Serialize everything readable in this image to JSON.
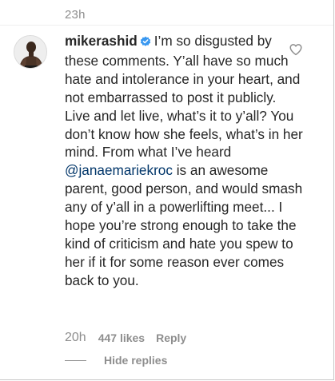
{
  "previous_comment": {
    "timestamp": "23h"
  },
  "comment": {
    "username": "mikerashid",
    "verified": true,
    "text_part1": "I’m so disgusted by these comments. Y’all have so much hate and intolerance in your heart, and not embarrassed to post it publicly. Live and let live, what’s it to y’all? You don’t know how she feels, what’s in her mind. From what I’ve heard ",
    "mention": "@janaemariekroc",
    "text_part2": " is an awesome parent, good person, and would smash any of y’all in a powerlifting meet... I hope you’re strong enough to take the kind of criticism and hate you spew to her if it for some reason ever comes back to you.",
    "timestamp": "20h",
    "likes": "447 likes",
    "reply_label": "Reply",
    "hide_replies_label": "Hide replies"
  },
  "icons": {
    "verified": "verified-badge-icon",
    "like": "heart-outline-icon",
    "avatar": "user-avatar"
  },
  "colors": {
    "text": "#262626",
    "muted": "#8e8e8e",
    "verified": "#3897f0",
    "mention": "#003569"
  }
}
